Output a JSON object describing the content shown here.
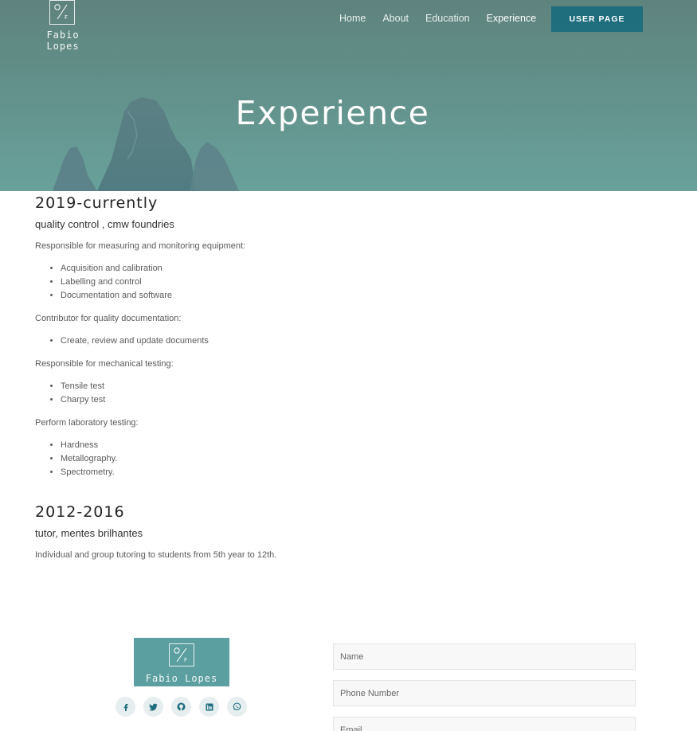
{
  "brand": {
    "name": "Fabio Lopes",
    "logo_icon": "fl-monogram-icon"
  },
  "nav": {
    "items": [
      {
        "label": "Home"
      },
      {
        "label": "About"
      },
      {
        "label": "Education"
      },
      {
        "label": "Experience",
        "active": true
      }
    ],
    "user_button": "USER PAGE"
  },
  "hero": {
    "title": "Experience"
  },
  "experience": [
    {
      "period": "2019-currently",
      "role": "quality control , cmw foundries",
      "groups": [
        {
          "text": "Responsible for measuring and monitoring equipment:",
          "items": [
            "Acquisition and calibration",
            "Labelling and control",
            "Documentation and software"
          ]
        },
        {
          "text": "Contributor for quality documentation:",
          "items": [
            "Create, review and update documents"
          ]
        },
        {
          "text": "Responsible for mechanical testing:",
          "items": [
            "Tensile test",
            "Charpy test"
          ]
        },
        {
          "text": "Perform laboratory testing:",
          "items": [
            "Hardness",
            "Metallography.",
            "Spectrometry."
          ]
        }
      ]
    },
    {
      "period": "2012-2016",
      "role": "tutor, mentes brilhantes",
      "groups": [
        {
          "text": "Individual and group tutoring to students from 5th year to 12th.",
          "items": []
        }
      ]
    }
  ],
  "footer": {
    "brand_name": "Fabio Lopes",
    "socials": [
      "facebook-icon",
      "twitter-icon",
      "github-icon",
      "linkedin-icon",
      "whatsapp-icon"
    ],
    "form": {
      "name_placeholder": "Name",
      "phone_placeholder": "Phone Number",
      "email_placeholder": "Email"
    }
  },
  "colors": {
    "accent": "#1e6e7e",
    "hero": "#62908a",
    "footer_logo_bg": "#5b9fa0"
  }
}
